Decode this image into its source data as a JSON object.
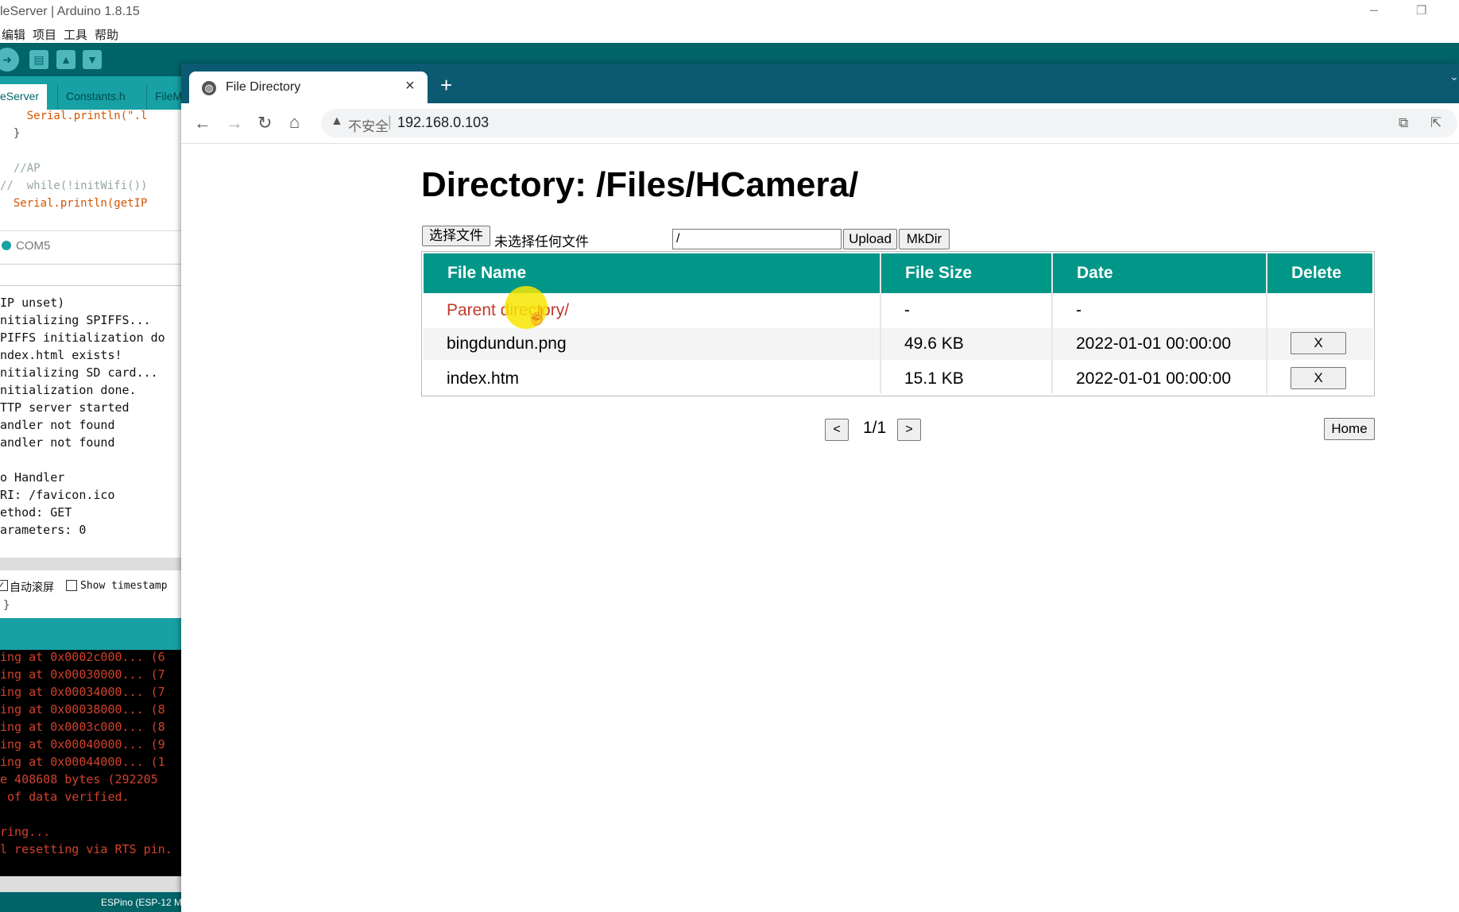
{
  "ide": {
    "title": "leServer | Arduino 1.8.15",
    "menu": [
      "编辑",
      "项目",
      "工具",
      "帮助"
    ],
    "tabs": [
      "eServer",
      "Constants.h",
      "FileM"
    ],
    "code_lines": [
      "    Serial.println(\".l",
      "  }",
      "",
      "  //AP",
      "//  while(!initWifi())",
      "  Serial.println(getIP"
    ],
    "serial_port": "COM5",
    "serial_lines": [
      "IP unset)",
      "nitializing SPIFFS...",
      "PIFFS initialization do",
      "ndex.html exists!",
      "nitializing SD card...",
      "nitialization done.",
      "TTP server started",
      "andler not found",
      "andler not found",
      "",
      "o Handler",
      "RI: /favicon.ico",
      "ethod: GET",
      "arameters: 0"
    ],
    "autoscroll_label": "自动滚屏",
    "timestamp_label": "Show timestamp",
    "brace": "}",
    "console_lines": [
      "ing at 0x0002c000... (6",
      "ing at 0x00030000... (7",
      "ing at 0x00034000... (7",
      "ing at 0x00038000... (8",
      "ing at 0x0003c000... (8",
      "ing at 0x00040000... (9",
      "ing at 0x00044000... (1",
      "e 408608 bytes (292205",
      " of data verified.",
      "",
      "ring...",
      "l resetting via RTS pin."
    ],
    "status": "ESPino (ESP-12 M"
  },
  "browser": {
    "tab_title": "File Directory",
    "insecure_label": "不安全",
    "url": "192.168.0.103"
  },
  "page": {
    "heading": "Directory:  /Files/HCamera/",
    "choose_file_label": "选择文件",
    "no_file_label": "未选择任何文件",
    "path_value": "/",
    "upload_label": "Upload",
    "mkdir_label": "MkDir",
    "columns": [
      "File Name",
      "File Size",
      "Date",
      "Delete"
    ],
    "parent": {
      "name": "Parent directory/",
      "size": "-",
      "date": "-"
    },
    "rows": [
      {
        "name": "bingdundun.png",
        "size": "49.6 KB",
        "date": "2022-01-01 00:00:00",
        "delete": "X"
      },
      {
        "name": "index.htm",
        "size": "15.1 KB",
        "date": "2022-01-01 00:00:00",
        "delete": "X"
      }
    ],
    "prev_label": "<",
    "pager": "1/1",
    "next_label": ">",
    "home_label": "Home"
  },
  "colors": {
    "ide_teal": "#006468",
    "tab_teal": "#17a1a5",
    "table_header": "#009688",
    "link_red": "#c0392b",
    "console_red": "#d2412c"
  }
}
